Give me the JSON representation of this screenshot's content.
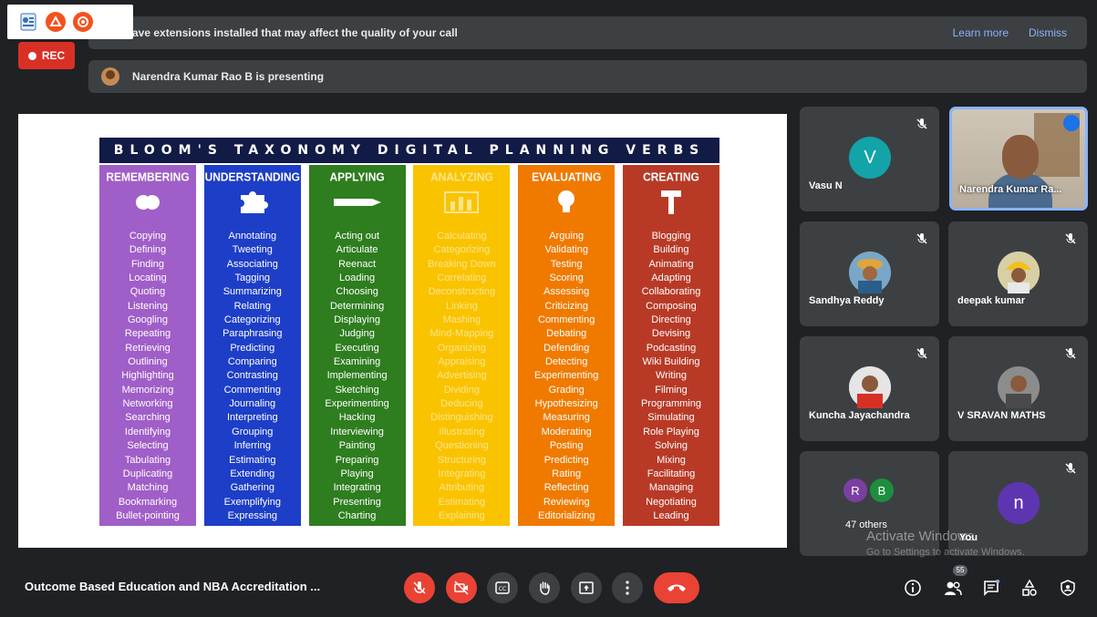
{
  "banner": {
    "message": "ave extensions installed that may affect the quality of your call",
    "learn_more": "Learn more",
    "dismiss": "Dismiss"
  },
  "rec_label": "REC",
  "presenting": {
    "text": "Narendra Kumar Rao B is presenting"
  },
  "slide": {
    "title": "BLOOM'S TAXONOMY DIGITAL PLANNING VERBS",
    "columns": [
      {
        "header": "REMEMBERING",
        "verbs": [
          "Copying",
          "Defining",
          "Finding",
          "Locating",
          "Quoting",
          "Listening",
          "Googling",
          "Repeating",
          "Retrieving",
          "Outlining",
          "Highlighting",
          "Memorizing",
          "Networking",
          "Searching",
          "Identifying",
          "Selecting",
          "Tabulating",
          "Duplicating",
          "Matching",
          "Bookmarking",
          "Bullet-pointing"
        ]
      },
      {
        "header": "UNDERSTANDING",
        "verbs": [
          "Annotating",
          "Tweeting",
          "Associating",
          "Tagging",
          "Summarizing",
          "Relating",
          "Categorizing",
          "Paraphrasing",
          "Predicting",
          "Comparing",
          "Contrasting",
          "Commenting",
          "Journaling",
          "Interpreting",
          "Grouping",
          "Inferring",
          "Estimating",
          "Extending",
          "Gathering",
          "Exemplifying",
          "Expressing"
        ]
      },
      {
        "header": "APPLYING",
        "verbs": [
          "Acting out",
          "Articulate",
          "Reenact",
          "Loading",
          "Choosing",
          "Determining",
          "Displaying",
          "Judging",
          "Executing",
          "Examining",
          "Implementing",
          "Sketching",
          "Experimenting",
          "Hacking",
          "Interviewing",
          "Painting",
          "Preparing",
          "Playing",
          "Integrating",
          "Presenting",
          "Charting"
        ]
      },
      {
        "header": "ANALYZING",
        "verbs": [
          "Calculating",
          "Categorizing",
          "Breaking Down",
          "Correlating",
          "Deconstructing",
          "Linking",
          "Mashing",
          "Mind-Mapping",
          "Organizing",
          "Appraising",
          "Advertising",
          "Dividing",
          "Deducing",
          "Distinguishing",
          "Illustrating",
          "Questioning",
          "Structuring",
          "Integrating",
          "Attributing",
          "Estimating",
          "Explaining"
        ]
      },
      {
        "header": "EVALUATING",
        "verbs": [
          "Arguing",
          "Validating",
          "Testing",
          "Scoring",
          "Assessing",
          "Criticizing",
          "Commenting",
          "Debating",
          "Defending",
          "Detecting",
          "Experimenting",
          "Grading",
          "Hypothesizing",
          "Measuring",
          "Moderating",
          "Posting",
          "Predicting",
          "Rating",
          "Reflecting",
          "Reviewing",
          "Editorializing"
        ]
      },
      {
        "header": "CREATING",
        "verbs": [
          "Blogging",
          "Building",
          "Animating",
          "Adapting",
          "Collaborating",
          "Composing",
          "Directing",
          "Devising",
          "Podcasting",
          "Wiki Building",
          "Writing",
          "Filming",
          "Programming",
          "Simulating",
          "Role Playing",
          "Solving",
          "Mixing",
          "Facilitating",
          "Managing",
          "Negotiating",
          "Leading"
        ]
      }
    ]
  },
  "participants": [
    {
      "name": "Vasu N",
      "initial": "V",
      "color": "#12a4a8"
    },
    {
      "name": "Narendra Kumar Ra..."
    },
    {
      "name": "Sandhya Reddy"
    },
    {
      "name": "deepak kumar"
    },
    {
      "name": "Kuncha Jayachandra"
    },
    {
      "name": "V SRAVAN MATHS"
    }
  ],
  "others": {
    "label": "47 others",
    "initials": [
      "R",
      "B"
    ]
  },
  "you": {
    "name": "You",
    "initial": "n"
  },
  "watermark": {
    "line1": "Activate Windows",
    "line2": "Go to Settings to activate Windows."
  },
  "meeting_title": "Outcome Based Education and NBA Accreditation ...",
  "people_count": "55",
  "icons": {
    "mic_off": "mic-off-icon",
    "cam_off": "camera-off-icon",
    "captions": "captions-icon",
    "hand": "raise-hand-icon",
    "present": "present-icon",
    "more": "more-options-icon",
    "end": "end-call-icon"
  },
  "colors": {
    "accent_red": "#ea4335",
    "accent_blue": "#8ab4f8",
    "panel": "#3c4043"
  }
}
